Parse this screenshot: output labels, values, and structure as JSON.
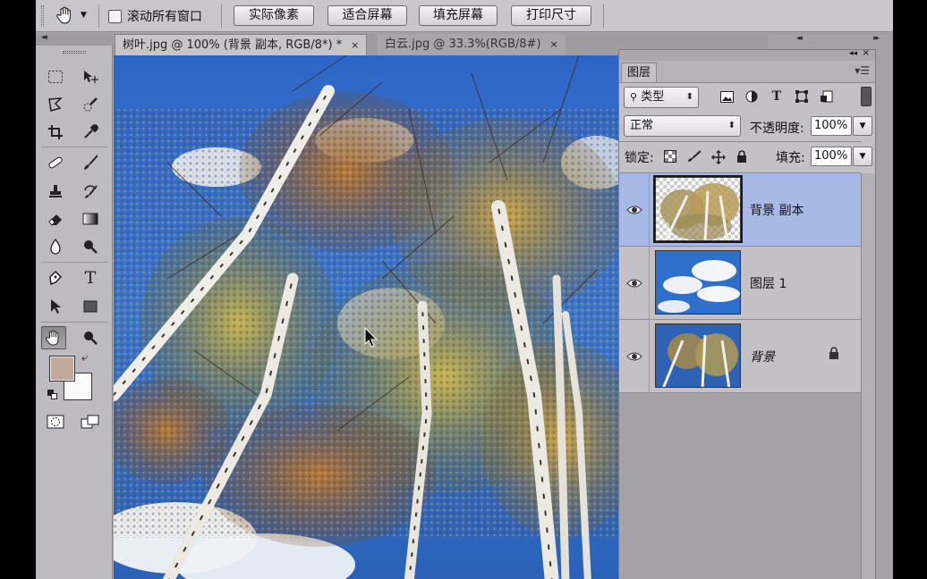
{
  "options_bar": {
    "scroll_all_windows_label": "滚动所有窗口",
    "scroll_all_windows_checked": false,
    "buttons": [
      "实际像素",
      "适合屏幕",
      "填充屏幕",
      "打印尺寸"
    ]
  },
  "tabs": [
    {
      "title": "树叶.jpg @ 100% (背景 副本, RGB/8*) *",
      "close": "×",
      "active": true
    },
    {
      "title": "白云.jpg @ 33.3%(RGB/8#)",
      "close": "×",
      "active": false
    }
  ],
  "toolbar": {
    "active_tool": "hand-tool",
    "foreground_color": "#c0a99b",
    "background_color": "#fafafa"
  },
  "layers_panel": {
    "title": "图层",
    "filter_kind": "类型",
    "blend_mode": "正常",
    "opacity_label": "不透明度:",
    "opacity_value": "100%",
    "lock_label": "锁定:",
    "fill_label": "填充:",
    "fill_value": "100%",
    "layers": [
      {
        "name": "背景 副本",
        "visible": true,
        "selected": true,
        "locked": false,
        "italic": false
      },
      {
        "name": "图层 1",
        "visible": true,
        "selected": false,
        "locked": false,
        "italic": false
      },
      {
        "name": "背景",
        "visible": true,
        "selected": false,
        "locked": true,
        "italic": true
      }
    ]
  },
  "icons": [
    "hand-icon",
    "marquee-icon",
    "move-icon",
    "lasso-icon",
    "quick-select-icon",
    "crop-icon",
    "eyedropper-icon",
    "healing-icon",
    "brush-icon",
    "stamp-icon",
    "history-brush-icon",
    "eraser-icon",
    "gradient-icon",
    "blur-icon",
    "dodge-icon",
    "pen-icon",
    "type-icon",
    "path-select-icon",
    "shape-icon",
    "zoom-icon",
    "quick-mask-icon",
    "screen-mode-icon",
    "eye-icon",
    "lock-icon"
  ]
}
